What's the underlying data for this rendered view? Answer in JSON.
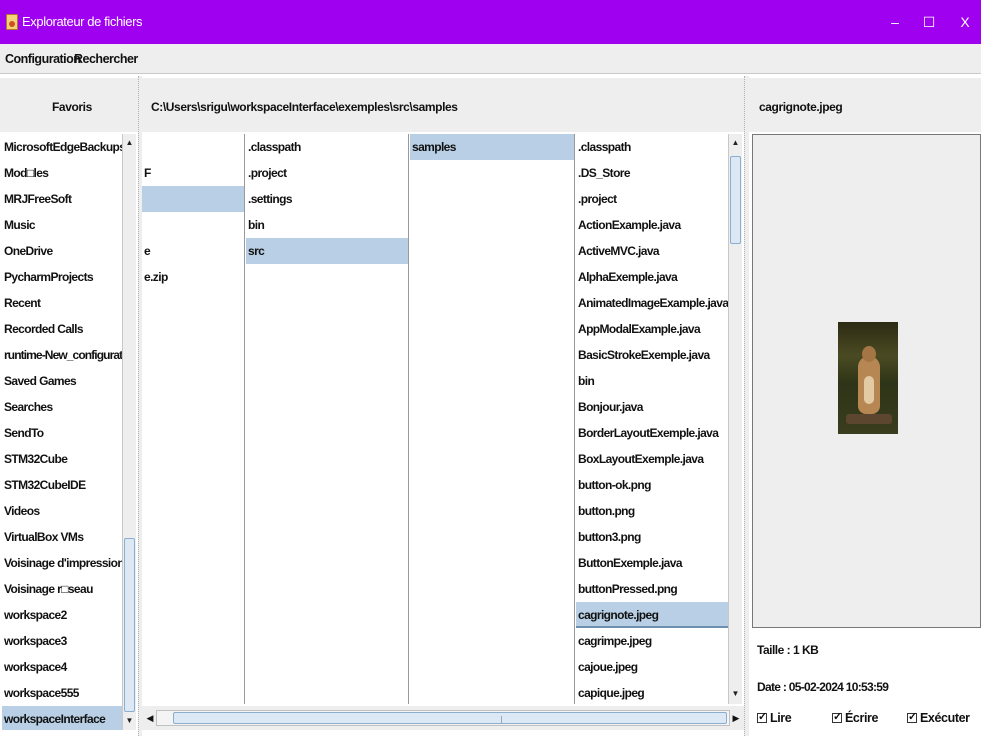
{
  "window": {
    "title": "Explorateur de fichiers",
    "controls": {
      "minimize": "–",
      "maximize": "☐",
      "close": "X"
    }
  },
  "menu": {
    "items": [
      "Configuration",
      "Rechercher"
    ]
  },
  "favorites": {
    "header": "Favoris",
    "items": [
      "MicrosoftEdgeBackups",
      "Mod□les",
      "MRJFreeSoft",
      "Music",
      "OneDrive",
      "PycharmProjects",
      "Recent",
      "Recorded Calls",
      "runtime-New_configuration",
      "Saved Games",
      "Searches",
      "SendTo",
      "STM32Cube",
      "STM32CubeIDE",
      "Videos",
      "VirtualBox VMs",
      "Voisinage d'impression",
      "Voisinage r□seau",
      "workspace2",
      "workspace3",
      "workspace4",
      "workspace555",
      "workspaceInterface"
    ],
    "selected": "workspaceInterface"
  },
  "browser": {
    "path": "C:\\Users\\srigu\\workspaceInterface\\exemples\\src\\samples",
    "col1": [
      "",
      "F",
      "",
      "",
      "e",
      "e.zip"
    ],
    "col1_selected_row": 2,
    "col2": [
      ".classpath",
      ".project",
      ".settings",
      "bin",
      "src"
    ],
    "col2_selected": "src",
    "col3": [
      "samples"
    ],
    "col3_selected": "samples",
    "col4": [
      ".classpath",
      ".DS_Store",
      ".project",
      "ActionExample.java",
      "ActiveMVC.java",
      "AlphaExemple.java",
      "AnimatedImageExample.java",
      "AppModalExample.java",
      "BasicStrokeExemple.java",
      "bin",
      "Bonjour.java",
      "BorderLayoutExemple.java",
      "BoxLayoutExemple.java",
      "button-ok.png",
      "button.png",
      "button3.png",
      "ButtonExemple.java",
      "buttonPressed.png",
      "cagrignote.jpeg",
      "cagrimpe.jpeg",
      "cajoue.jpeg",
      "capique.jpeg"
    ],
    "col4_selected": "cagrignote.jpeg"
  },
  "preview": {
    "filename": "cagrignote.jpeg",
    "image_icon": "squirrel-photo",
    "size": "Taille : 1 KB",
    "date": "Date : 05-02-2024 10:53:59",
    "permissions": {
      "read": "Lire",
      "write": "Écrire",
      "execute": "Exécuter"
    }
  },
  "colors": {
    "titlebar": "#a000f0",
    "selection": "#b8cfe5",
    "panel_bg": "#eeeeee"
  }
}
